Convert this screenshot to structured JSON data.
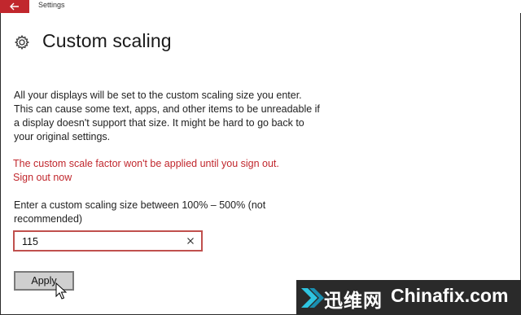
{
  "window": {
    "title": "Settings"
  },
  "page": {
    "title": "Custom scaling"
  },
  "description": "All your displays will be set to the custom scaling size you enter. This can cause some text, apps, and other items to be unreadable if a display doesn't support that size. It might be hard to go back to your original settings.",
  "warning": "The custom scale factor won't be applied until you sign out.",
  "signout_link": "Sign out now",
  "prompt": "Enter a custom scaling size between 100% – 500% (not recommended)",
  "input": {
    "value": "115"
  },
  "apply_label": "Apply",
  "watermark": {
    "cn": "迅维网",
    "en": "Chinafix.com"
  },
  "icons": [
    "back-arrow-icon",
    "gear-icon",
    "clear-icon",
    "mouse-pointer-icon"
  ],
  "colors": {
    "accent": "#c1272d",
    "input_border": "#c0504d",
    "button_bg": "#cfcfcf"
  }
}
